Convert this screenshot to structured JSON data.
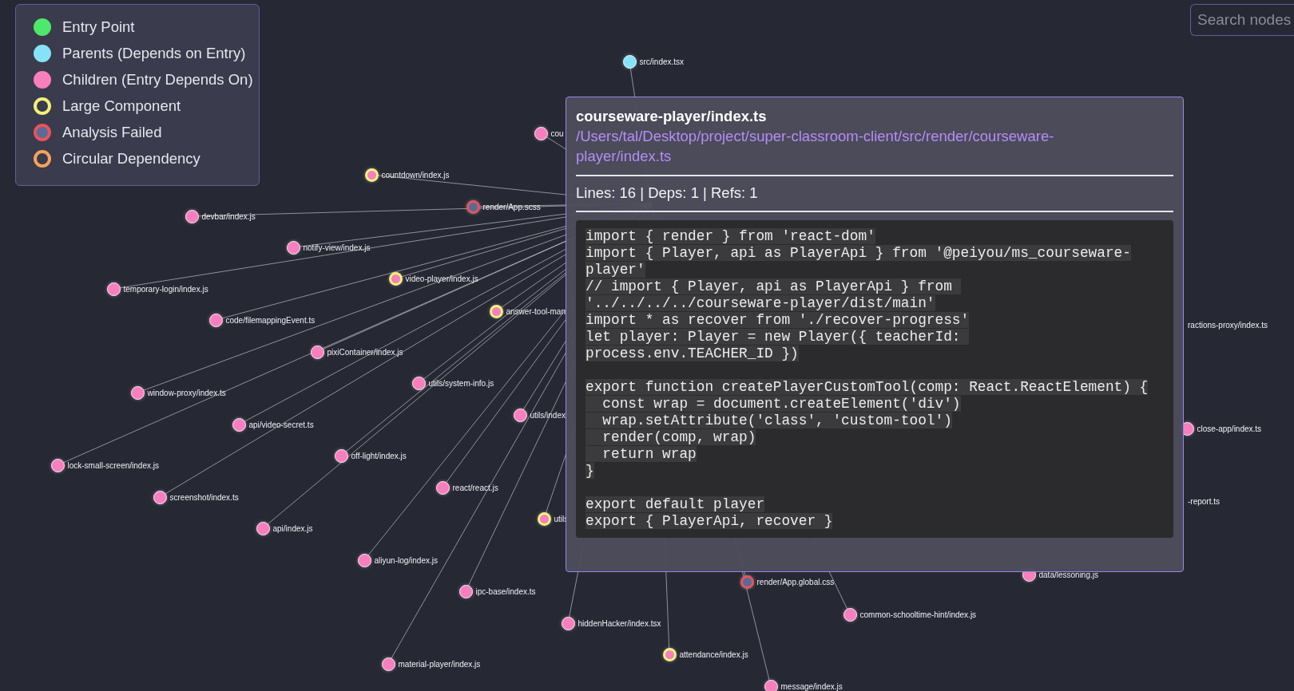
{
  "legend": [
    {
      "label": "Entry Point",
      "kind": "filled",
      "color": "#4ee86a"
    },
    {
      "label": "Parents (Depends on Entry)",
      "kind": "filled",
      "color": "#86e3f7"
    },
    {
      "label": "Children (Entry Depends On)",
      "kind": "filled",
      "color": "#f77fbe"
    },
    {
      "label": "Large Component",
      "kind": "ring",
      "color": "#f2f27a"
    },
    {
      "label": "Analysis Failed",
      "kind": "failed",
      "color": "#e8545a"
    },
    {
      "label": "Circular Dependency",
      "kind": "ring",
      "color": "#f5a35a"
    }
  ],
  "search": {
    "placeholder": "Search nodes"
  },
  "nodes": [
    {
      "label": "src/index.tsx",
      "kind": "parent"
    },
    {
      "label": "cou",
      "kind": "child"
    },
    {
      "label": "countdown/index.js",
      "kind": "large"
    },
    {
      "label": "render/App.scss",
      "kind": "failed"
    },
    {
      "label": "devbar/index.js",
      "kind": "child"
    },
    {
      "label": "notify-view/index.js",
      "kind": "child"
    },
    {
      "label": "video-player/index.js",
      "kind": "large"
    },
    {
      "label": "temporary-login/index.js",
      "kind": "child"
    },
    {
      "label": "answer-tool-man",
      "kind": "large"
    },
    {
      "label": "code/filemappingEvent.ts",
      "kind": "child"
    },
    {
      "label": "ractions-proxy/index.ts",
      "kind": "label"
    },
    {
      "label": "pixiContainer/index.js",
      "kind": "child"
    },
    {
      "label": "utils/system-info.js",
      "kind": "child"
    },
    {
      "label": "window-proxy/index.ts",
      "kind": "child"
    },
    {
      "label": "utils/index",
      "kind": "child"
    },
    {
      "label": "api/video-secret.ts",
      "kind": "child"
    },
    {
      "label": "close-app/index.ts",
      "kind": "child"
    },
    {
      "label": "off-light/index.js",
      "kind": "child"
    },
    {
      "label": "lock-small-screen/index.js",
      "kind": "child"
    },
    {
      "label": "react/react.js",
      "kind": "child"
    },
    {
      "label": "screenshot/index.ts",
      "kind": "child"
    },
    {
      "label": "-report.ts",
      "kind": "label"
    },
    {
      "label": "utils",
      "kind": "large"
    },
    {
      "label": "api/index.js",
      "kind": "child"
    },
    {
      "label": "aliyun-log/index.js",
      "kind": "child"
    },
    {
      "label": "data/lessoning.js",
      "kind": "child"
    },
    {
      "label": "render/App.global.css",
      "kind": "failed"
    },
    {
      "label": "ipc-base/index.ts",
      "kind": "child"
    },
    {
      "label": "common-schooltime-hint/index.js",
      "kind": "child"
    },
    {
      "label": "hiddenHacker/index.tsx",
      "kind": "child"
    },
    {
      "label": "attendance/index.js",
      "kind": "large"
    },
    {
      "label": "material-player/index.js",
      "kind": "child"
    },
    {
      "label": "message/index.js",
      "kind": "child"
    }
  ],
  "tooltip": {
    "title": "courseware-player/index.ts",
    "path": "/Users/tal/Desktop/project/super-classroom-client/src/render/courseware-player/index.ts",
    "stats": "Lines: 16 | Deps: 1 | Refs: 1",
    "code": "import { render } from 'react-dom'\nimport { Player, api as PlayerApi } from '@peiyou/ms_courseware-player'\n// import { Player, api as PlayerApi } from '../../../../courseware-player/dist/main'\nimport * as recover from './recover-progress'\nlet player: Player = new Player({ teacherId: process.env.TEACHER_ID })\n\nexport function createPlayerCustomTool(comp: React.ReactElement) {\n  const wrap = document.createElement('div')\n  wrap.setAttribute('class', 'custom-tool')\n  render(comp, wrap)\n  return wrap\n}\n\nexport default player\nexport { PlayerApi, recover }"
  }
}
